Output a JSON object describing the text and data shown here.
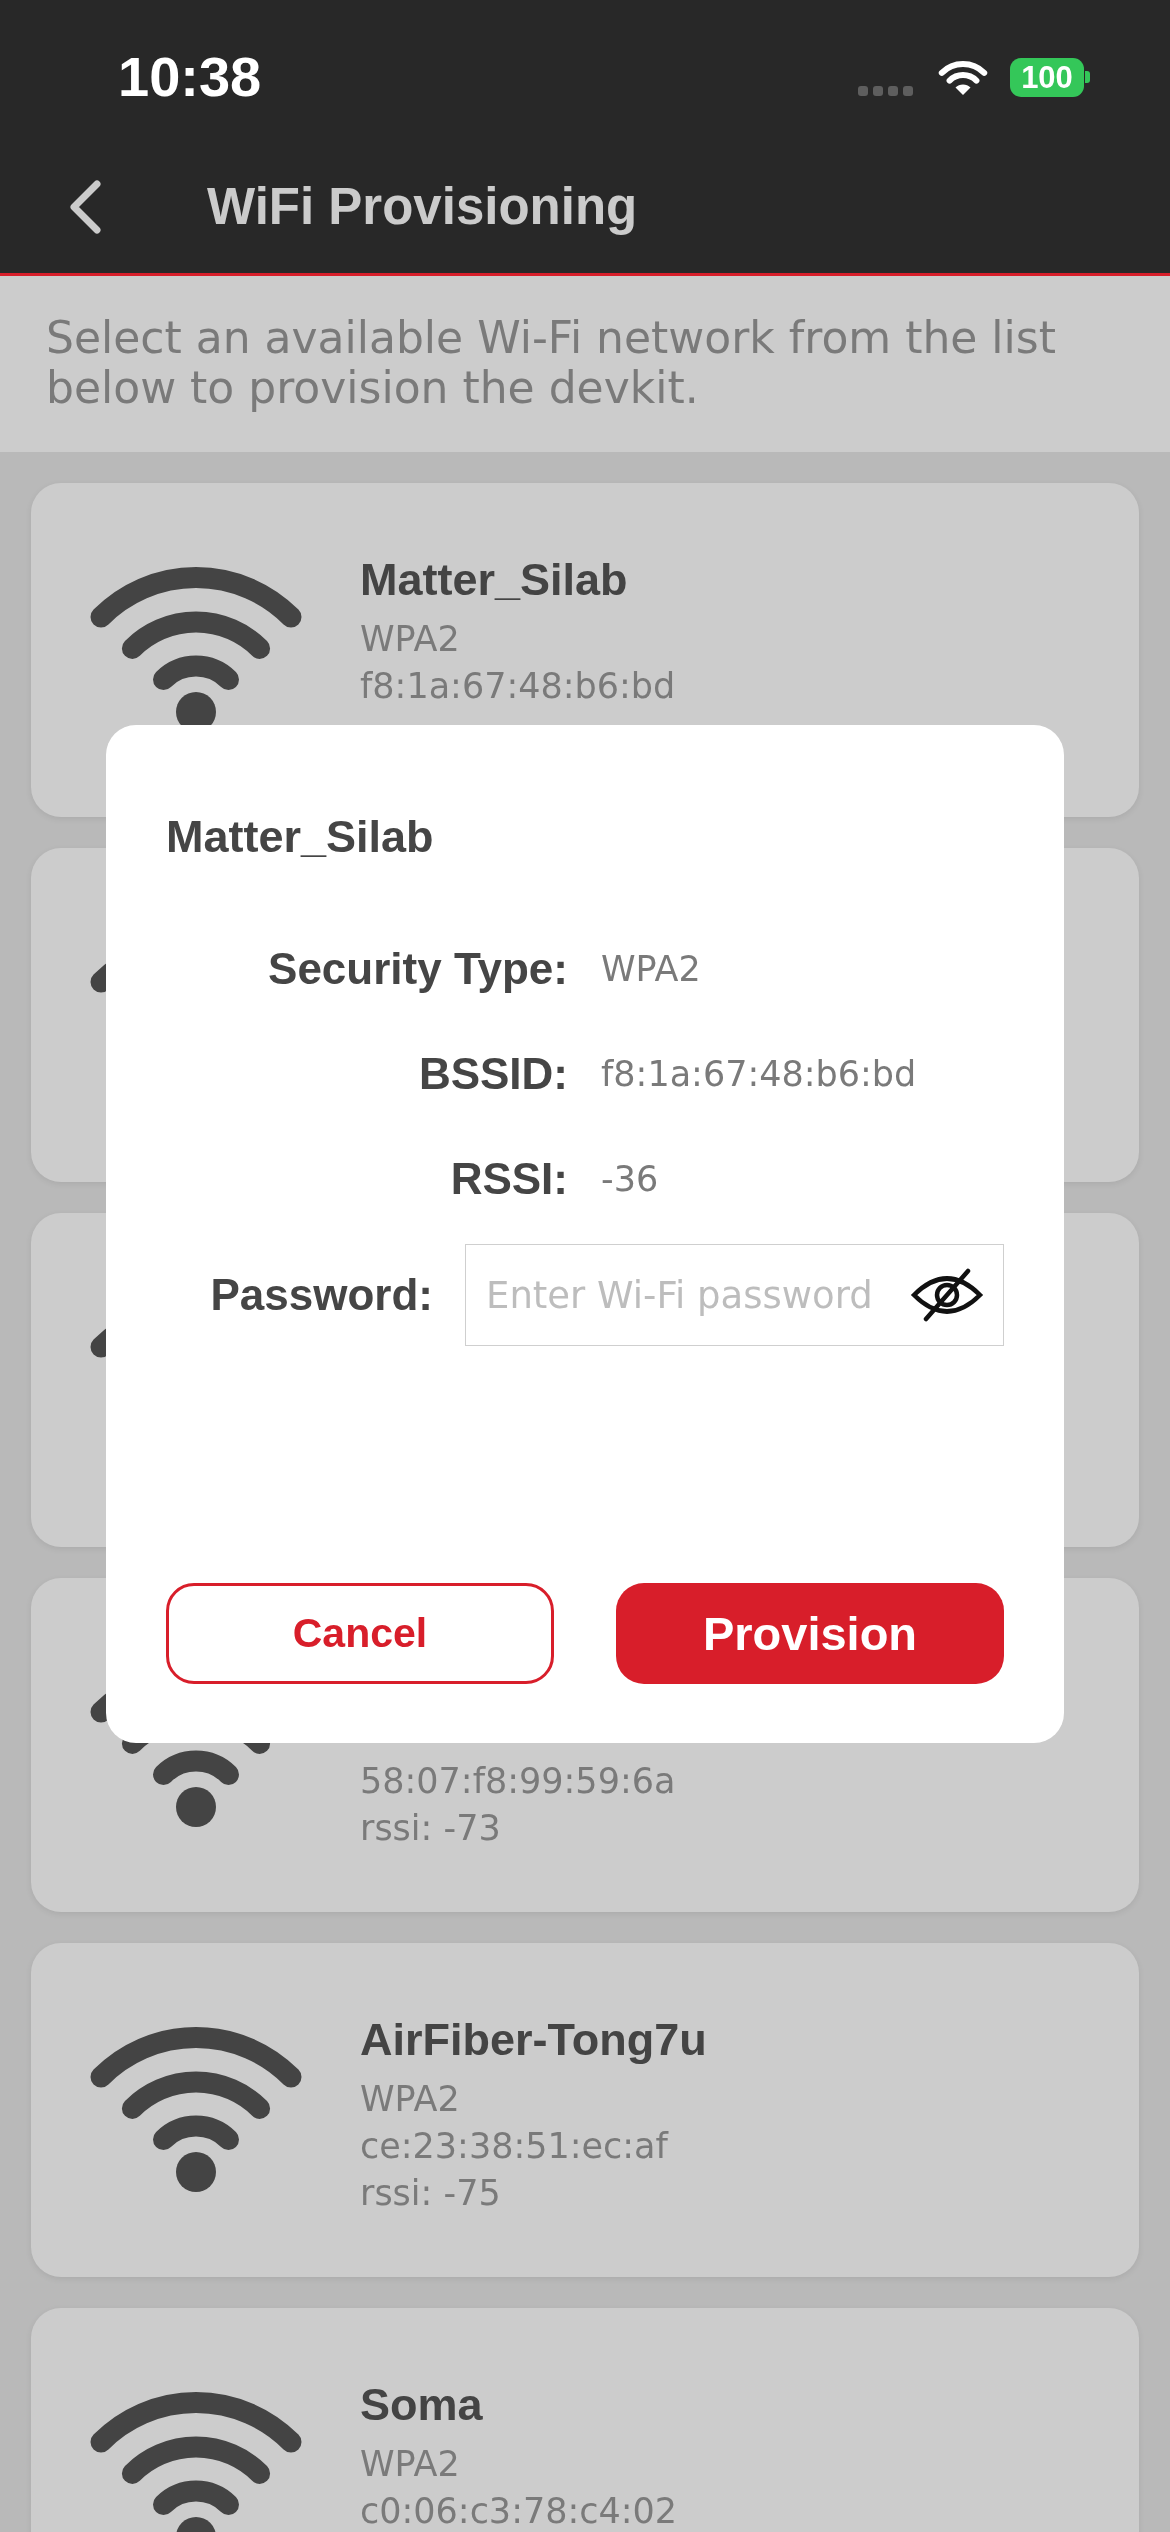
{
  "status_bar": {
    "time": "10:38",
    "battery": "100"
  },
  "header": {
    "title": "WiFi Provisioning"
  },
  "description": "Select an available Wi-Fi network from the list below to provision the devkit.",
  "networks": [
    {
      "kind": "network",
      "name": "Matter_Silab",
      "security": "WPA2",
      "bssid": "f8:1a:67:48:b6:bd"
    },
    {
      "kind": "network"
    },
    {
      "kind": "network"
    },
    {
      "kind": "network",
      "bssid": "58:07:f8:99:59:6a",
      "rssi": "rssi: -73"
    },
    {
      "kind": "network",
      "name": "AirFiber-Tong7u",
      "security": "WPA2",
      "bssid": "ce:23:38:51:ec:af",
      "rssi": "rssi: -75"
    },
    {
      "kind": "network",
      "name": "Soma",
      "security": "WPA2",
      "bssid": "c0:06:c3:78:c4:02"
    }
  ],
  "dialog": {
    "title": "Matter_Silab",
    "fields": [
      {
        "label": "Security Type:",
        "value": "WPA2"
      },
      {
        "label": "BSSID:",
        "value": "f8:1a:67:48:b6:bd"
      },
      {
        "label": "RSSI:",
        "value": "-36"
      }
    ],
    "password": {
      "label": "Password:",
      "placeholder": "Enter Wi-Fi password"
    },
    "buttons": [
      {
        "label": "Cancel",
        "kind": "cancel"
      },
      {
        "label": "Provision",
        "kind": "provision"
      }
    ]
  }
}
